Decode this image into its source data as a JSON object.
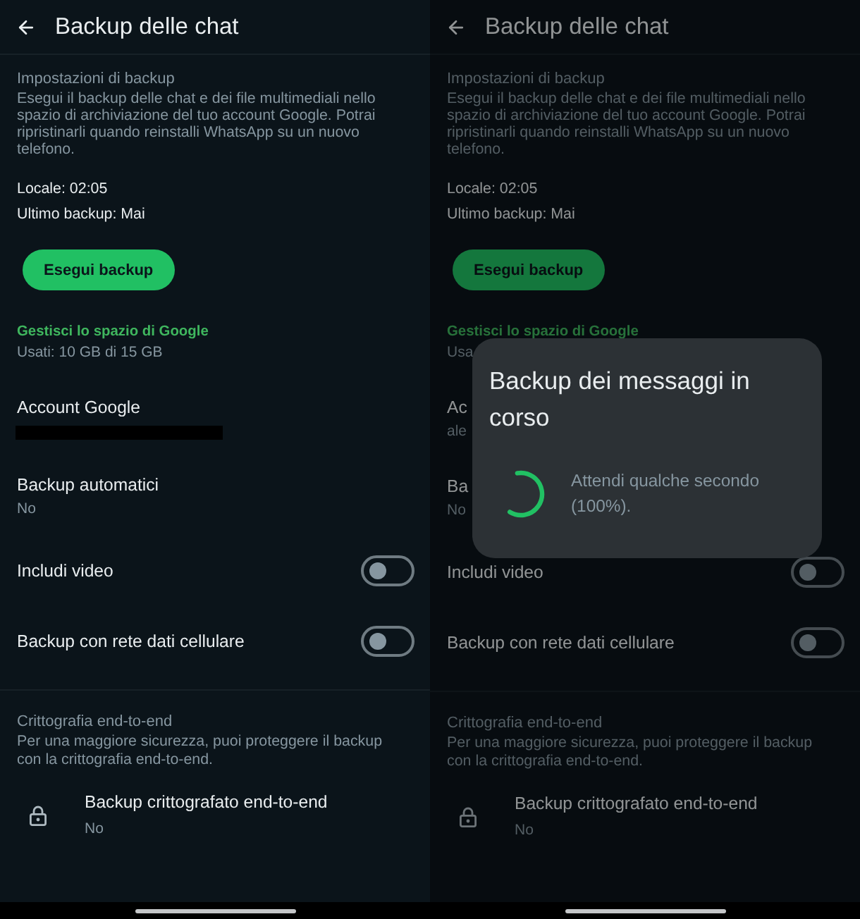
{
  "screens": [
    {
      "title": "Backup delle chat",
      "settings": {
        "heading": "Impostazioni di backup",
        "description": "Esegui il backup delle chat e dei file multimediali nello spazio di archiviazione del tuo account Google. Potrai ripristinarli quando reinstalli WhatsApp su un nuovo telefono.",
        "local": "Locale: 02:05",
        "last_backup": "Ultimo backup: Mai",
        "button": "Esegui backup"
      },
      "storage": {
        "link": "Gestisci lo spazio di Google",
        "usage": "Usati: 10 GB di 15 GB"
      },
      "items": [
        {
          "kind": "value",
          "label": "Account Google",
          "redacted": true
        },
        {
          "kind": "value",
          "label": "Backup automatici",
          "value": "No"
        },
        {
          "kind": "toggle",
          "label": "Includi video",
          "on": false
        },
        {
          "kind": "toggle",
          "label": "Backup con rete dati cellulare",
          "on": false
        }
      ],
      "encryption": {
        "heading": "Crittografia end-to-end",
        "description": "Per una maggiore sicurezza, puoi proteggere il backup con la crittografia end-to-end.",
        "label": "Backup crittografato end-to-end",
        "value": "No"
      }
    },
    {
      "title": "Backup delle chat",
      "settings": {
        "heading": "Impostazioni di backup",
        "description": "Esegui il backup delle chat e dei file multimediali nello spazio di archiviazione del tuo account Google. Potrai ripristinarli quando reinstalli WhatsApp su un nuovo telefono.",
        "local": "Locale: 02:05",
        "last_backup": "Ultimo backup: Mai",
        "button": "Esegui backup"
      },
      "storage": {
        "link": "Gestisci lo spazio di Google",
        "usage": "Usa"
      },
      "items": [
        {
          "kind": "value",
          "label": "Ac",
          "value": "ale"
        },
        {
          "kind": "value",
          "label": "Ba",
          "value": "No"
        },
        {
          "kind": "toggle",
          "label": "Includi video",
          "on": false
        },
        {
          "kind": "toggle",
          "label": "Backup con rete dati cellulare",
          "on": false
        }
      ],
      "encryption": {
        "heading": "Crittografia end-to-end",
        "description": "Per una maggiore sicurezza, puoi proteggere il backup con la crittografia end-to-end.",
        "label": "Backup crittografato end-to-end",
        "value": "No"
      },
      "dialog": {
        "title": "Backup dei messaggi in corso",
        "message": "Attendi qualche secondo (100%)."
      }
    }
  ]
}
